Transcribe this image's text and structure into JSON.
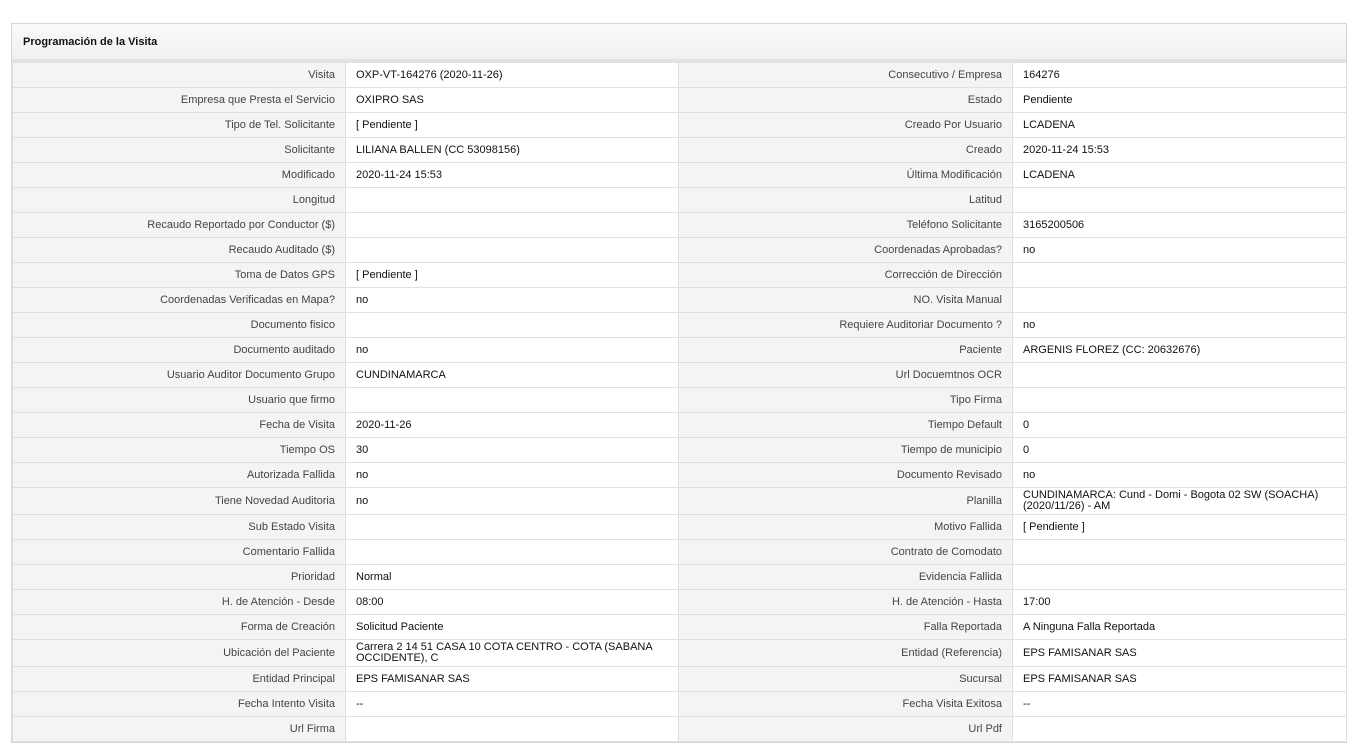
{
  "panel": {
    "title": "Programación de la Visita"
  },
  "rows": [
    {
      "l1": "Visita",
      "v1": "OXP-VT-164276 (2020-11-26)",
      "l2": "Consecutivo / Empresa",
      "v2": "164276"
    },
    {
      "l1": "Empresa que Presta el Servicio",
      "v1": "OXIPRO SAS",
      "l2": "Estado",
      "v2": "Pendiente"
    },
    {
      "l1": "Tipo de Tel. Solicitante",
      "v1": "[ Pendiente ]",
      "l2": "Creado Por Usuario",
      "v2": "LCADENA"
    },
    {
      "l1": "Solicitante",
      "v1": "LILIANA BALLEN (CC 53098156)",
      "l2": "Creado",
      "v2": "2020-11-24 15:53"
    },
    {
      "l1": "Modificado",
      "v1": "2020-11-24 15:53",
      "l2": "Última Modificación",
      "v2": " LCADENA"
    },
    {
      "l1": "Longitud",
      "v1": "",
      "l2": "Latitud",
      "v2": ""
    },
    {
      "l1": "Recaudo Reportado por Conductor ($)",
      "v1": "",
      "l2": "Teléfono Solicitante",
      "v2": "3165200506"
    },
    {
      "l1": "Recaudo Auditado ($)",
      "v1": "",
      "l2": "Coordenadas Aprobadas?",
      "v2": " no"
    },
    {
      "l1": "Toma de Datos GPS",
      "v1": "[ Pendiente ]",
      "l2": "Corrección de Dirección",
      "v2": ""
    },
    {
      "l1": "Coordenadas Verificadas en Mapa?",
      "v1": " no",
      "l2": "NO. Visita Manual",
      "v2": ""
    },
    {
      "l1": "Documento fisico",
      "v1": "",
      "l2": "Requiere Auditoriar Documento ?",
      "v2": " no"
    },
    {
      "l1": "Documento auditado",
      "v1": " no",
      "l2": "Paciente",
      "v2": "ARGENIS FLOREZ (CC: 20632676)"
    },
    {
      "l1": "Usuario Auditor Documento Grupo",
      "v1": "CUNDINAMARCA",
      "l2": "Url Docuemtnos OCR",
      "v2": ""
    },
    {
      "l1": "Usuario que firmo",
      "v1": "",
      "l2": "Tipo Firma",
      "v2": ""
    },
    {
      "l1": "Fecha de Visita",
      "v1": " 2020-11-26",
      "l2": "Tiempo Default",
      "v2": "0"
    },
    {
      "l1": "Tiempo OS",
      "v1": "30",
      "l2": "Tiempo de municipio",
      "v2": "0"
    },
    {
      "l1": "Autorizada Fallida",
      "v1": " no",
      "l2": "Documento Revisado",
      "v2": " no"
    },
    {
      "l1": "Tiene Novedad Auditoria",
      "v1": " no",
      "l2": "Planilla",
      "v2": "CUNDINAMARCA: Cund - Domi - Bogota 02 SW (SOACHA) (2020/11/26) - AM",
      "tall": true
    },
    {
      "l1": "Sub Estado Visita",
      "v1": "",
      "l2": "Motivo Fallida",
      "v2": "[ Pendiente ]"
    },
    {
      "l1": "Comentario Fallida",
      "v1": "",
      "l2": "Contrato de Comodato",
      "v2": ""
    },
    {
      "l1": "Prioridad",
      "v1": "Normal",
      "l2": "Evidencia Fallida",
      "v2": ""
    },
    {
      "l1": "H. de Atención - Desde",
      "v1": "08:00",
      "l2": "H. de Atención - Hasta",
      "v2": "17:00"
    },
    {
      "l1": "Forma de Creación",
      "v1": "Solicitud Paciente",
      "l2": "Falla Reportada",
      "v2": "A Ninguna Falla Reportada"
    },
    {
      "l1": "Ubicación del Paciente",
      "v1": "Carrera 2 14 51 CASA 10 COTA CENTRO - COTA (SABANA OCCIDENTE), C",
      "l2": "Entidad (Referencia)",
      "v2": "EPS FAMISANAR SAS",
      "tall": true
    },
    {
      "l1": "Entidad Principal",
      "v1": "EPS FAMISANAR SAS",
      "l2": "Sucursal",
      "v2": "EPS FAMISANAR SAS"
    },
    {
      "l1": "Fecha Intento Visita",
      "v1": " --",
      "l2": "Fecha Visita Exitosa",
      "v2": " --"
    },
    {
      "l1": "Url Firma",
      "v1": "",
      "l2": "Url Pdf",
      "v2": ""
    }
  ]
}
